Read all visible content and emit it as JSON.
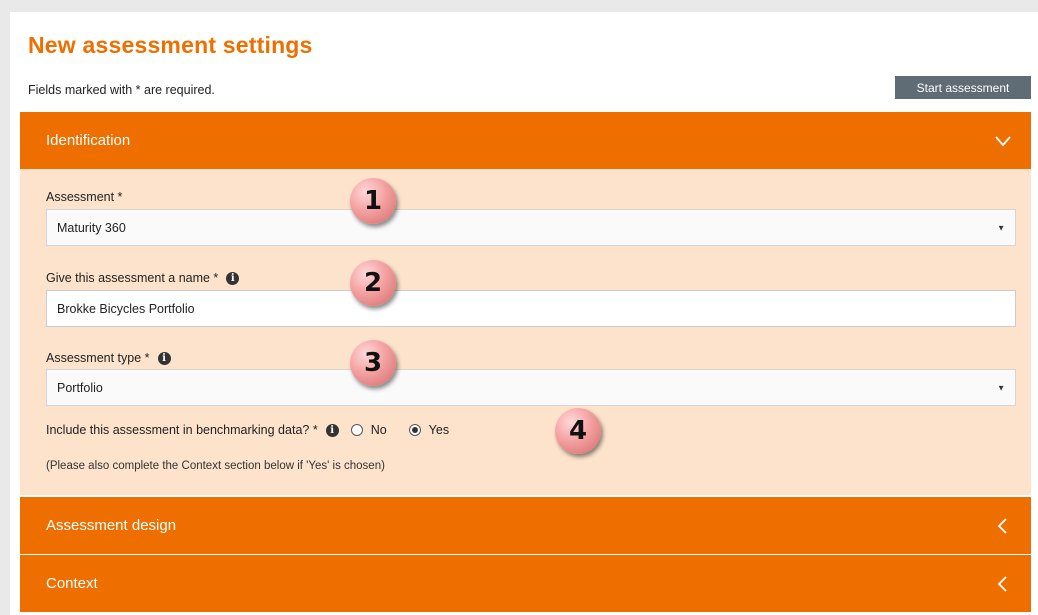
{
  "title": "New assessment settings",
  "required_note": "Fields marked with * are required.",
  "start_button": "Start assessment",
  "sections": {
    "identification": {
      "label": "Identification",
      "state": "expanded",
      "icon": "chevron-down-icon"
    },
    "design": {
      "label": "Assessment design",
      "state": "collapsed",
      "icon": "chevron-left-icon"
    },
    "context": {
      "label": "Context",
      "state": "collapsed",
      "icon": "chevron-left-icon"
    }
  },
  "form": {
    "assessment": {
      "label": "Assessment *",
      "value": "Maturity 360"
    },
    "name": {
      "label": "Give this assessment a name *",
      "value": "Brokke Bicycles Portfolio"
    },
    "type": {
      "label": "Assessment type *",
      "value": "Portfolio"
    },
    "benchmark": {
      "label": "Include this assessment in benchmarking data? *",
      "options": [
        "No",
        "Yes"
      ],
      "selected": "Yes",
      "hint": "(Please also complete the Context section below if 'Yes' is chosen)"
    }
  },
  "callouts": [
    "1",
    "2",
    "3",
    "4"
  ],
  "colors": {
    "accent": "#ee6f00",
    "panel": "#fde3cc",
    "button": "#5f6b75"
  }
}
